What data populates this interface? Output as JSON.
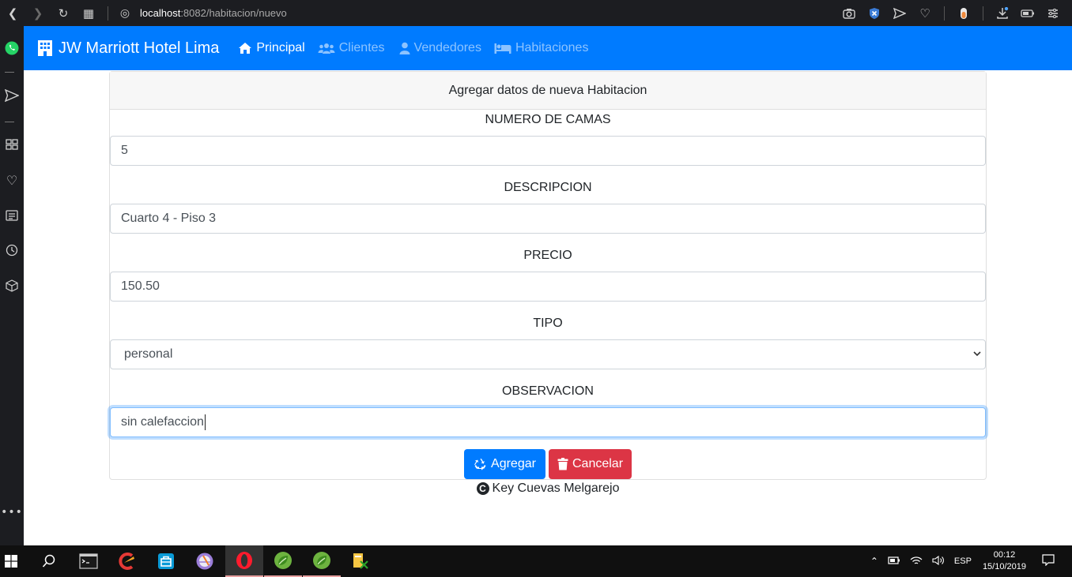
{
  "browser": {
    "url_host": "localhost",
    "url_path": ":8082/habitacion/nuevo",
    "icons": [
      "back-icon",
      "forward-icon",
      "reload-icon",
      "speed-dial-icon",
      "globe-icon",
      "camera-icon",
      "shield-icon",
      "send-icon",
      "heart-icon",
      "extension-icon",
      "download-icon",
      "battery-icon",
      "menu-icon"
    ]
  },
  "navbar": {
    "brand": "JW Marriott Hotel Lima",
    "items": [
      {
        "label": "Principal",
        "icon": "home-icon",
        "active": true
      },
      {
        "label": "Clientes",
        "icon": "users-icon",
        "active": false
      },
      {
        "label": "Vendedores",
        "icon": "user-icon",
        "active": false
      },
      {
        "label": "Habitaciones",
        "icon": "bed-icon",
        "active": false
      }
    ]
  },
  "form": {
    "header": "Agregar datos de nueva Habitacion",
    "fields": [
      {
        "label": "NUMERO DE CAMAS",
        "value": "5"
      },
      {
        "label": "DESCRIPCION",
        "value": "Cuarto 4 - Piso 3"
      },
      {
        "label": "PRECIO",
        "value": "150.50"
      },
      {
        "label": "TIPO",
        "value": "personal"
      },
      {
        "label": "OBSERVACION",
        "value": "sin calefaccion"
      }
    ],
    "submit_label": "Agregar",
    "cancel_label": "Cancelar"
  },
  "footer": {
    "text": "Key Cuevas Melgarejo"
  },
  "taskbar": {
    "language": "ESP",
    "time": "00:12",
    "date": "15/10/2019"
  },
  "colors": {
    "primary": "#007bff",
    "danger": "#dc3545",
    "browser_chrome": "#1c1d21"
  }
}
